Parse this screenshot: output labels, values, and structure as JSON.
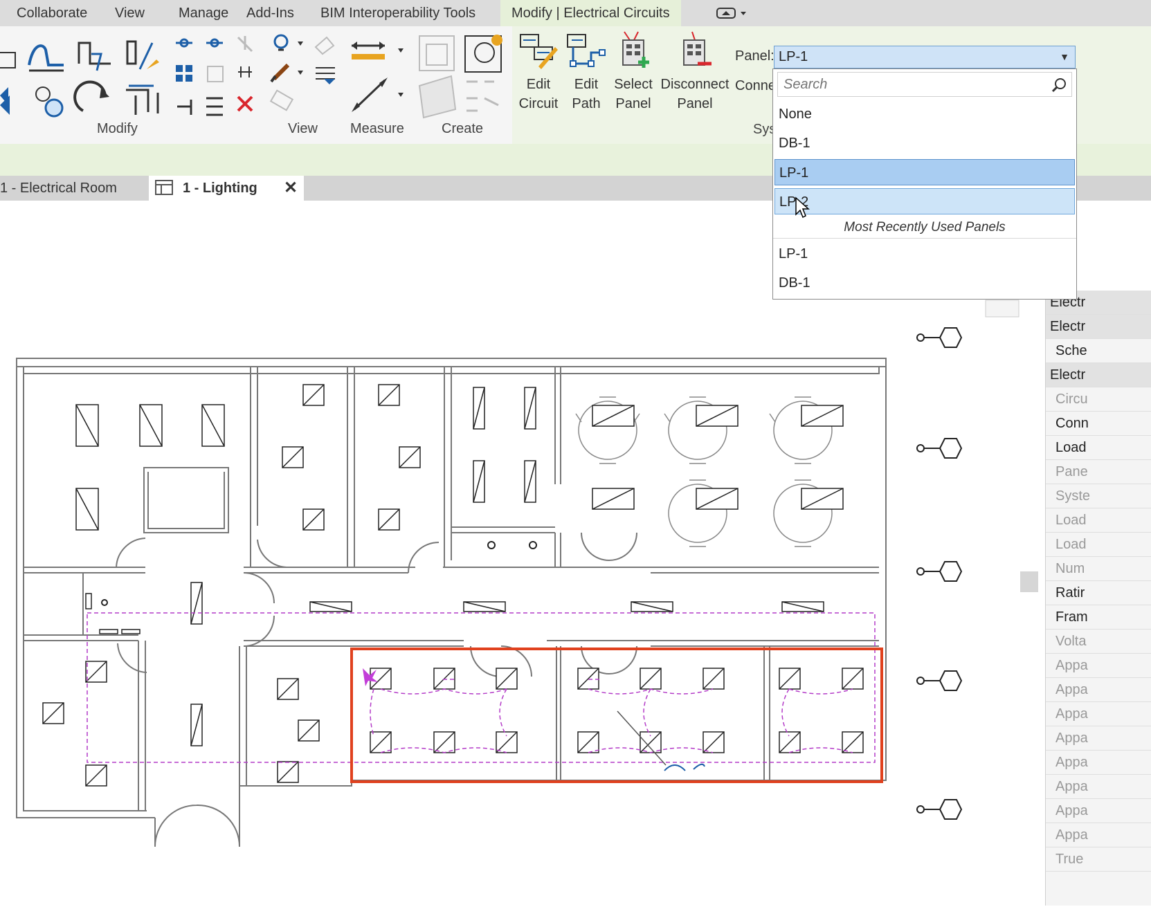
{
  "menu": {
    "items": [
      "Collaborate",
      "View",
      "Manage",
      "Add-Ins",
      "BIM Interoperability Tools"
    ],
    "active_tab": "Modify | Electrical Circuits"
  },
  "ribbon": {
    "groups": {
      "modify": "Modify",
      "view": "View",
      "measure": "Measure",
      "create": "Create",
      "system": "Sys"
    },
    "buttons": {
      "edit_circuit": [
        "Edit",
        "Circuit"
      ],
      "edit_path": [
        "Edit",
        "Path"
      ],
      "select_panel": [
        "Select",
        "Panel"
      ],
      "disconnect_panel": [
        "Disconnect",
        "Panel"
      ]
    },
    "panel_label": "Panel:",
    "connect_label": "Conne"
  },
  "panel_combo": {
    "value": "LP-1",
    "search_placeholder": "Search",
    "options": [
      "None",
      "DB-1",
      "LP-1",
      "LP-2"
    ],
    "selected": "LP-1",
    "hovered": "LP-2",
    "mru_header": "Most Recently Used Panels",
    "mru": [
      "LP-1",
      "DB-1"
    ]
  },
  "view_tabs": {
    "inactive": "1 - Electrical Room",
    "active": "1 - Lighting",
    "close_glyph": "✕"
  },
  "properties": {
    "rows": [
      {
        "text": "Electr",
        "kind": "hdr"
      },
      {
        "text": "Electr",
        "kind": "hdr"
      },
      {
        "text": "Sche",
        "kind": "normal"
      },
      {
        "text": "Electr",
        "kind": "hdr"
      },
      {
        "text": "Circu",
        "kind": "gray"
      },
      {
        "text": "Conn",
        "kind": "normal"
      },
      {
        "text": "Load",
        "kind": "normal"
      },
      {
        "text": "Pane",
        "kind": "gray"
      },
      {
        "text": "Syste",
        "kind": "gray"
      },
      {
        "text": "Load",
        "kind": "gray"
      },
      {
        "text": "Load",
        "kind": "gray"
      },
      {
        "text": "Num",
        "kind": "gray"
      },
      {
        "text": "Ratir",
        "kind": "normal"
      },
      {
        "text": "Fram",
        "kind": "normal"
      },
      {
        "text": "Volta",
        "kind": "gray"
      },
      {
        "text": "Appa",
        "kind": "gray"
      },
      {
        "text": "Appa",
        "kind": "gray"
      },
      {
        "text": "Appa",
        "kind": "gray"
      },
      {
        "text": "Appa",
        "kind": "gray"
      },
      {
        "text": "Appa",
        "kind": "gray"
      },
      {
        "text": "Appa",
        "kind": "gray"
      },
      {
        "text": "Appa",
        "kind": "gray"
      },
      {
        "text": "Appa",
        "kind": "gray"
      },
      {
        "text": "True",
        "kind": "gray"
      }
    ]
  },
  "colors": {
    "selection_box": "#e0411e",
    "circuit_wire": "#b43cc8",
    "accent_blue": "#1d5fa8"
  }
}
